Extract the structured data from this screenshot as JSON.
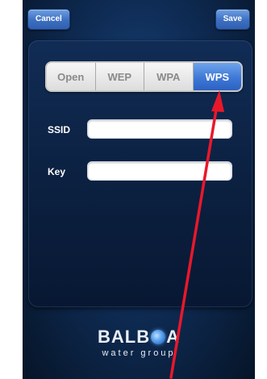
{
  "header": {
    "cancel_label": "Cancel",
    "save_label": "Save"
  },
  "security": {
    "options": [
      "Open",
      "WEP",
      "WPA",
      "WPS"
    ],
    "selected": "WPS"
  },
  "fields": {
    "ssid_label": "SSID",
    "ssid_value": "",
    "key_label": "Key",
    "key_value": ""
  },
  "logo": {
    "brand_part1": "BALB",
    "brand_part2": "A",
    "tagline": "water group"
  },
  "colors": {
    "accent": "#3f78d6",
    "background": "#0f2d57",
    "annotation_arrow": "#e8182b"
  }
}
